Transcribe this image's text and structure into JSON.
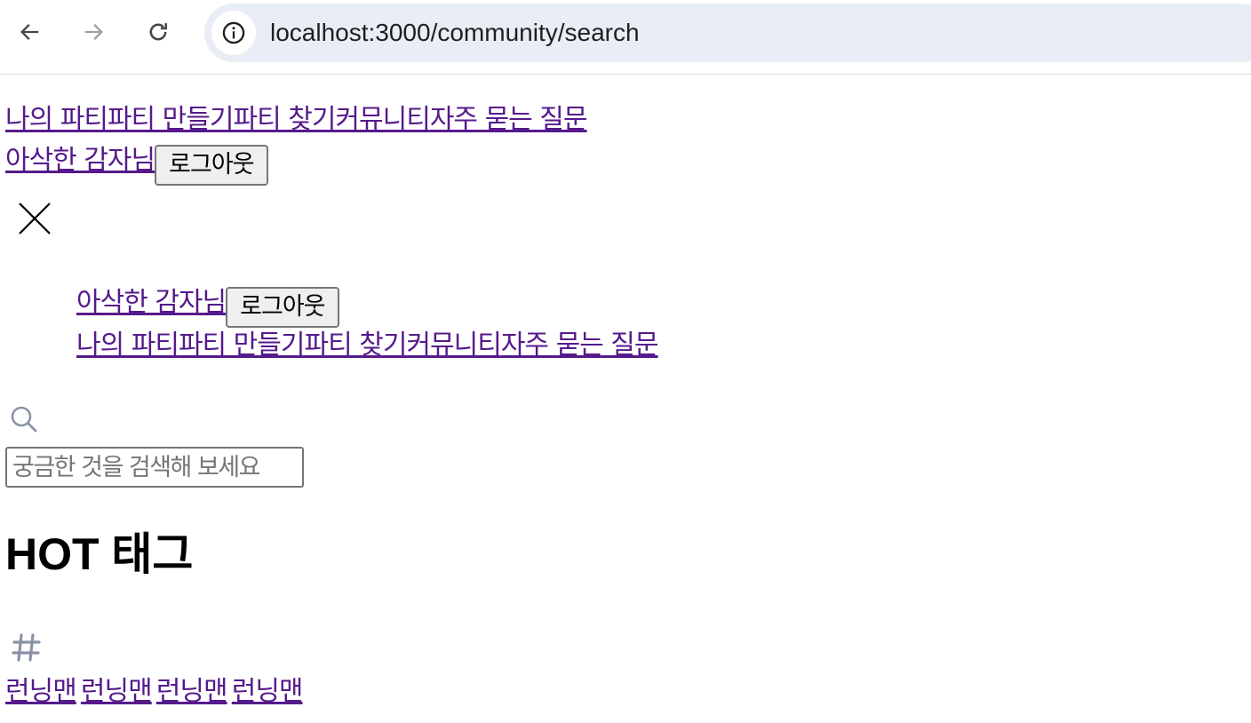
{
  "browser": {
    "url": "localhost:3000/community/search",
    "icons": {
      "back": "arrow-left-icon",
      "forward": "arrow-right-icon",
      "reload": "reload-icon",
      "site_info": "info-icon"
    }
  },
  "header": {
    "nav": {
      "my_party": "나의 파티",
      "create_party": "파티 만들기",
      "find_party": "파티 찾기",
      "community": "커뮤니티",
      "faq": "자주 묻는 질문"
    },
    "user_name": "아삭한 감자님",
    "logout_label": "로그아웃"
  },
  "mobile_menu": {
    "close_icon": "close-icon",
    "user_name": "아삭한 감자님",
    "logout_label": "로그아웃",
    "nav": {
      "my_party": "나의 파티",
      "create_party": "파티 만들기",
      "find_party": "파티 찾기",
      "community": "커뮤니티",
      "faq": "자주 묻는 질문"
    }
  },
  "search": {
    "icon": "search-icon",
    "placeholder": "궁금한 것을 검색해 보세요"
  },
  "hot_tags": {
    "title": "HOT 태그",
    "icon": "hash-icon",
    "tags": [
      "런닝맨",
      "런닝맨",
      "런닝맨",
      "런닝맨"
    ]
  },
  "colors": {
    "link": "#551a8b",
    "omnibox": "#e9edf6",
    "icon_gray": "#8a93a6"
  }
}
